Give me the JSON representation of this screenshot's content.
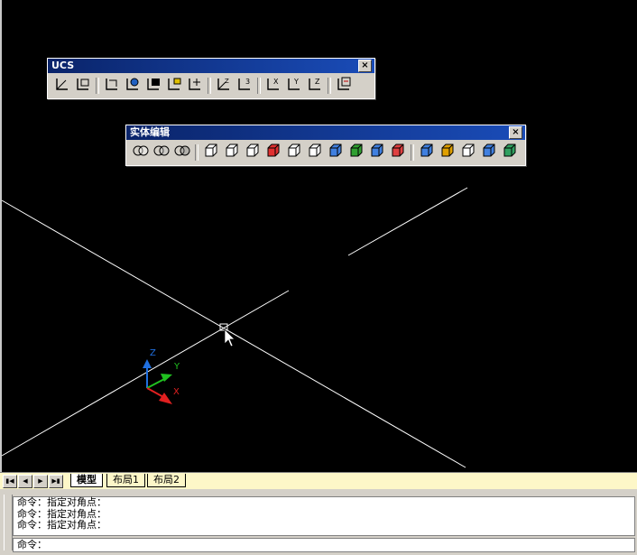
{
  "toolbars": {
    "ucs": {
      "title": "UCS",
      "close_label": "×",
      "buttons": [
        "ucs-icon",
        "ucs-previous-icon",
        "world-ucs-icon",
        "object-ucs-icon",
        "face-ucs-icon",
        "view-ucs-icon",
        "origin-ucs-icon",
        "z-axis-vector-ucs-icon",
        "3point-ucs-icon",
        "x-axis-rotate-ucs-icon",
        "y-axis-rotate-ucs-icon",
        "z-axis-rotate-ucs-icon",
        "apply-ucs-icon"
      ]
    },
    "solid_editing": {
      "title": "实体编辑",
      "close_label": "×",
      "buttons": [
        "union-icon",
        "subtract-icon",
        "intersect-icon",
        "extrude-faces-icon",
        "move-faces-icon",
        "offset-faces-icon",
        "delete-faces-icon",
        "rotate-faces-icon",
        "taper-faces-icon",
        "copy-faces-icon",
        "color-faces-icon",
        "copy-edges-icon",
        "color-edges-icon",
        "imprint-icon",
        "clean-icon",
        "separate-icon",
        "shell-icon",
        "check-icon"
      ]
    }
  },
  "ucs_icon": {
    "x_label": "X",
    "y_label": "Y",
    "z_label": "Z"
  },
  "layout_tabs": {
    "nav": [
      "first-tab-icon",
      "prev-tab-icon",
      "next-tab-icon",
      "last-tab-icon"
    ],
    "tabs": [
      {
        "label": "模型",
        "active": true
      },
      {
        "label": "布局1",
        "active": false
      },
      {
        "label": "布局2",
        "active": false
      }
    ]
  },
  "command_line": {
    "history": [
      "命令：指定对角点：",
      "命令：指定对角点：",
      "命令：指定对角点："
    ],
    "prompt": "命令："
  },
  "colors": {
    "canvas": "#000000",
    "lines": "#ffffff",
    "title_bar": "#0a246a",
    "tab_bar": "#fdf7c8",
    "x_axis": "#e02020",
    "y_axis": "#20c020",
    "z_axis": "#2070e0"
  }
}
